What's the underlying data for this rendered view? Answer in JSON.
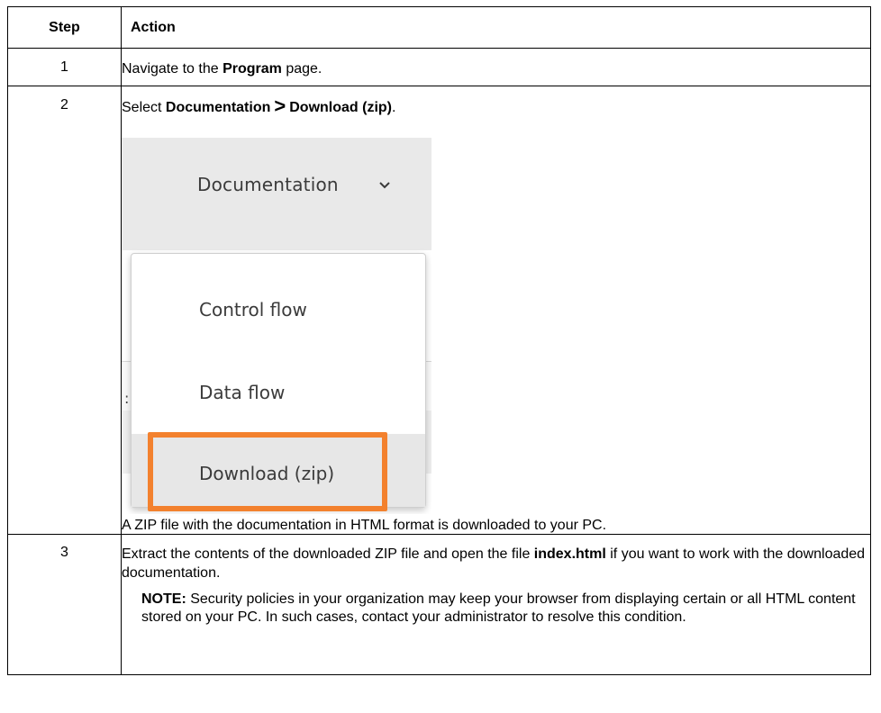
{
  "table": {
    "header": {
      "step": "Step",
      "action": "Action"
    },
    "row1": {
      "num": "1",
      "text_a": "Navigate to the ",
      "text_bold": "Program",
      "text_b": " page."
    },
    "row2": {
      "num": "2",
      "text_a": "Select ",
      "bold1": "Documentation",
      "sep": ">",
      "bold2": "Download (zip)",
      "text_end": ".",
      "after": "A ZIP file with the documentation in HTML format is downloaded to your PC."
    },
    "row3": {
      "num": "3",
      "text_a": "Extract the contents of the downloaded ZIP file and open the file ",
      "bold": "index.html",
      "text_b": " if you want to work with the downloaded documentation.",
      "note_label": "NOTE:",
      "note_text": " Security policies in your organization may keep your browser from displaying certain or all HTML content stored on your PC. In such cases, contact your administrator to resolve this condition."
    }
  },
  "screenshot": {
    "menu_button": "Documentation",
    "menu_button_icon": "chevron-down-icon",
    "items": [
      "Control flow",
      "Data flow",
      "Download (zip)"
    ],
    "highlight_color": "#f3812e"
  }
}
